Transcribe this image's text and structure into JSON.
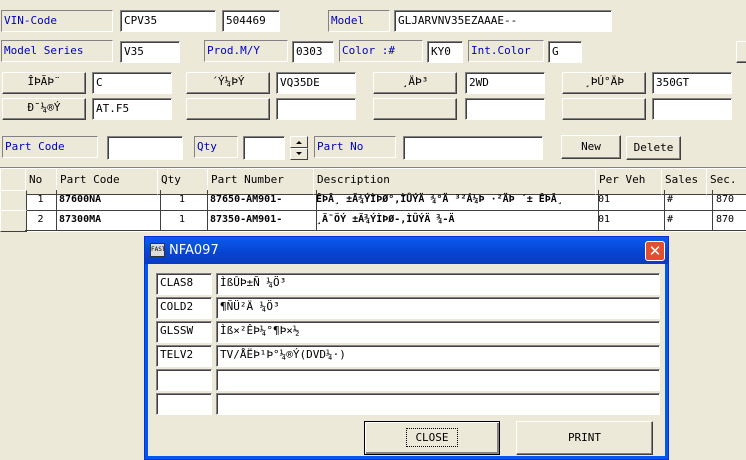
{
  "header": {
    "vin_label": "VIN-Code",
    "vin_value": "CPV35",
    "vin_value2": "504469",
    "model_label": "Model",
    "model_value": "GLJARVNV35EZAAAE--",
    "series_label": "Model Series",
    "series_value": "V35",
    "prodmy_label": "Prod.M/Y",
    "prodmy_value": "0303",
    "color_label": "Color :#",
    "color_value": "KY0",
    "intcolor_label": "Int.Color",
    "intcolor_value": "G"
  },
  "attributes": {
    "btn1_label": "ÎÞÃÞ¨",
    "btn1_value": "C",
    "btn2_label": "´Ý¼ÞÝ",
    "btn2_value": "VQ35DE",
    "btn3_label": "¸ÄÞ³",
    "btn3_value": "2WD",
    "btn4_label": "¸ÞÚ°ÄÞ",
    "btn4_value": "350GT",
    "btn5_label": "Ð¯¼®Ý",
    "btn5_value": "AT.F5"
  },
  "search": {
    "partcode_label": "Part Code",
    "partcode_value": "",
    "qty_label": "Qty",
    "qty_value": "",
    "partno_label": "Part No",
    "partno_value": "",
    "new_label": "New",
    "delete_label": "Delete"
  },
  "grid": {
    "columns": [
      "No",
      "Part Code",
      "Qty",
      "Part Number",
      "Description",
      "Per Veh",
      "Sales",
      "Sec."
    ],
    "rows": [
      [
        "1",
        "87600NA",
        "1",
        "87650-AM901-",
        "ÊÞÂ¸ ±Ã¾ÝÌÞØ°,ÌÛÝÄ ¾°Ä ³²Á¼Þ ·²ÄÞ ´± ÊÞÂ¸",
        "01",
        "#",
        "870"
      ],
      [
        "2",
        "87300MA",
        "1",
        "87350-AM901-",
        "¸Ã¯ÖÝ ±Ã¾ÝÌÞØ-,ÌÛÝÄ ¾-Ä",
        "01",
        "#",
        "870"
      ]
    ]
  },
  "dialog": {
    "title": "NFA097",
    "icon_text": "FAST",
    "rows": [
      [
        "CLAS8",
        "ÌßÛÞ±Ñ ¼Ö³"
      ],
      [
        "COLD2",
        "¶Ñ­Ü²Ä ¼Ö³"
      ],
      [
        "GLSSW",
        "Ìß×²ÊÞ¼°¶Þ×½"
      ],
      [
        "TELV2",
        "TV/ÅËÞ¹Þ°¼®Ý(DVD¼·)"
      ],
      [
        "",
        ""
      ],
      [
        "",
        ""
      ]
    ],
    "close_label": "CLOSE",
    "print_label": "PRINT"
  }
}
